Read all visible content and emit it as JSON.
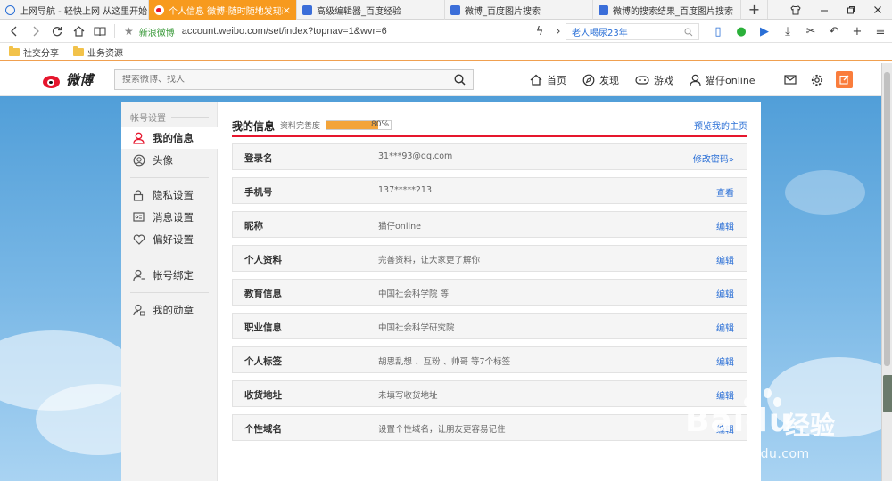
{
  "browser": {
    "tabs": [
      {
        "title": "上网导航 - 轻快上网 从这里开始",
        "icon": "globe-icon",
        "active": false
      },
      {
        "title": "个人信息 微博-随时随地发现新鲜事",
        "icon": "weibo-icon",
        "active": true
      },
      {
        "title": "高级编辑器_百度经验",
        "icon": "doc-icon",
        "active": false
      },
      {
        "title": "微博_百度图片搜索",
        "icon": "doc-icon",
        "active": false
      },
      {
        "title": "微博的搜索结果_百度图片搜索",
        "icon": "doc-icon",
        "active": false
      }
    ],
    "new_tab": "+",
    "close_symbol": "×",
    "site_tag": "新浪微博",
    "url": "account.weibo.com/set/index?topnav=1&wvr=6",
    "search_text": "老人喝尿23年",
    "bookmarks": [
      "社交分享",
      "业务资源"
    ]
  },
  "weibo": {
    "logo_text": "微博",
    "search_placeholder": "搜索微博、找人",
    "nav": [
      {
        "label": "首页",
        "icon": "home-icon"
      },
      {
        "label": "发现",
        "icon": "compass-icon"
      },
      {
        "label": "游戏",
        "icon": "gamepad-icon"
      },
      {
        "label": "猫仔online",
        "icon": "user-icon"
      }
    ],
    "icons": [
      "mail-icon",
      "gear-icon",
      "compose-icon"
    ]
  },
  "sidebar": {
    "heading": "帐号设置",
    "groups": [
      [
        {
          "label": "我的信息",
          "icon": "user-icon",
          "active": true
        },
        {
          "label": "头像",
          "icon": "avatar-icon",
          "active": false
        }
      ],
      [
        {
          "label": "隐私设置",
          "icon": "lock-icon",
          "active": false
        },
        {
          "label": "消息设置",
          "icon": "message-icon",
          "active": false
        },
        {
          "label": "偏好设置",
          "icon": "heart-icon",
          "active": false
        }
      ],
      [
        {
          "label": "帐号绑定",
          "icon": "user-link-icon",
          "active": false
        }
      ],
      [
        {
          "label": "我的勋章",
          "icon": "medal-icon",
          "active": false
        }
      ]
    ]
  },
  "main": {
    "title": "我的信息",
    "completeness_label": "资料完善度",
    "completeness_percent": 80,
    "completeness_text": "80%",
    "preview_link": "预览我的主页",
    "rows": [
      {
        "label": "登录名",
        "value": "31***93@qq.com",
        "action": "修改密码»"
      },
      {
        "label": "手机号",
        "value": "137*****213",
        "action": "查看"
      },
      {
        "label": "昵称",
        "value": "猫仔online",
        "action": "编辑"
      },
      {
        "label": "个人资料",
        "value": "完善资料，让大家更了解你",
        "action": "编辑"
      },
      {
        "label": "教育信息",
        "value": "中国社会科学院 等",
        "action": "编辑"
      },
      {
        "label": "职业信息",
        "value": "中国社会科学研究院",
        "action": "编辑"
      },
      {
        "label": "个人标签",
        "value": "胡思乱想 、互粉 、帅哥 等7个标签",
        "action": "编辑"
      },
      {
        "label": "收货地址",
        "value": "未填写收货地址",
        "action": "编辑"
      },
      {
        "label": "个性域名",
        "value": "设置个性域名，让朋友更容易记住",
        "action": "编辑"
      }
    ]
  },
  "watermark": {
    "brand": "Baidu",
    "cn": "经验",
    "url": "jingyan.baidu.com"
  }
}
